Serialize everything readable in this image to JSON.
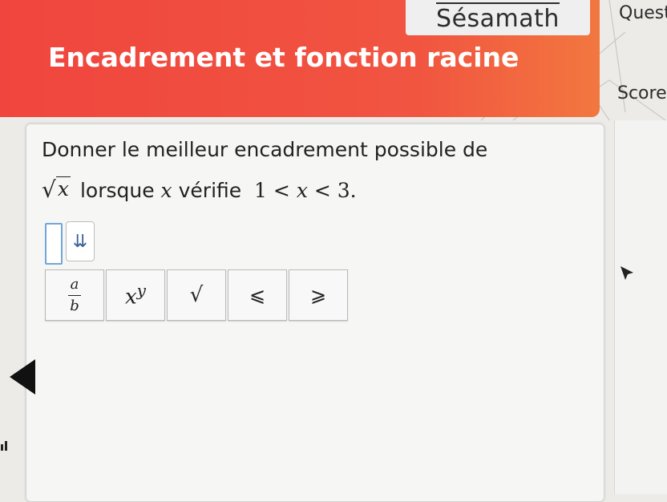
{
  "brand": {
    "name": "Sésamath"
  },
  "header": {
    "title": "Encadrement et fonction racine"
  },
  "side_panel": {
    "question_label": "Quest",
    "score_label": "Score"
  },
  "exercise": {
    "line1": "Donner le meilleur encadrement possible de",
    "sqrt_var": "x",
    "line2_word": "lorsque",
    "var": "x",
    "line2_verb": "vérifie",
    "ineq_left": "1 <",
    "ineq_var": "x",
    "ineq_right": "< 3."
  },
  "sort_button": {
    "icon": "double-down-arrow-icon",
    "glyph": "⇊"
  },
  "toolbar": {
    "fraction": {
      "num": "a",
      "den": "b"
    },
    "power": {
      "base": "x",
      "exp": "y"
    },
    "sqrt": "√",
    "leq": "⩽",
    "geq": "⩾"
  },
  "colors": {
    "banner": "#f0453e",
    "answer_border": "#72a6d8"
  }
}
